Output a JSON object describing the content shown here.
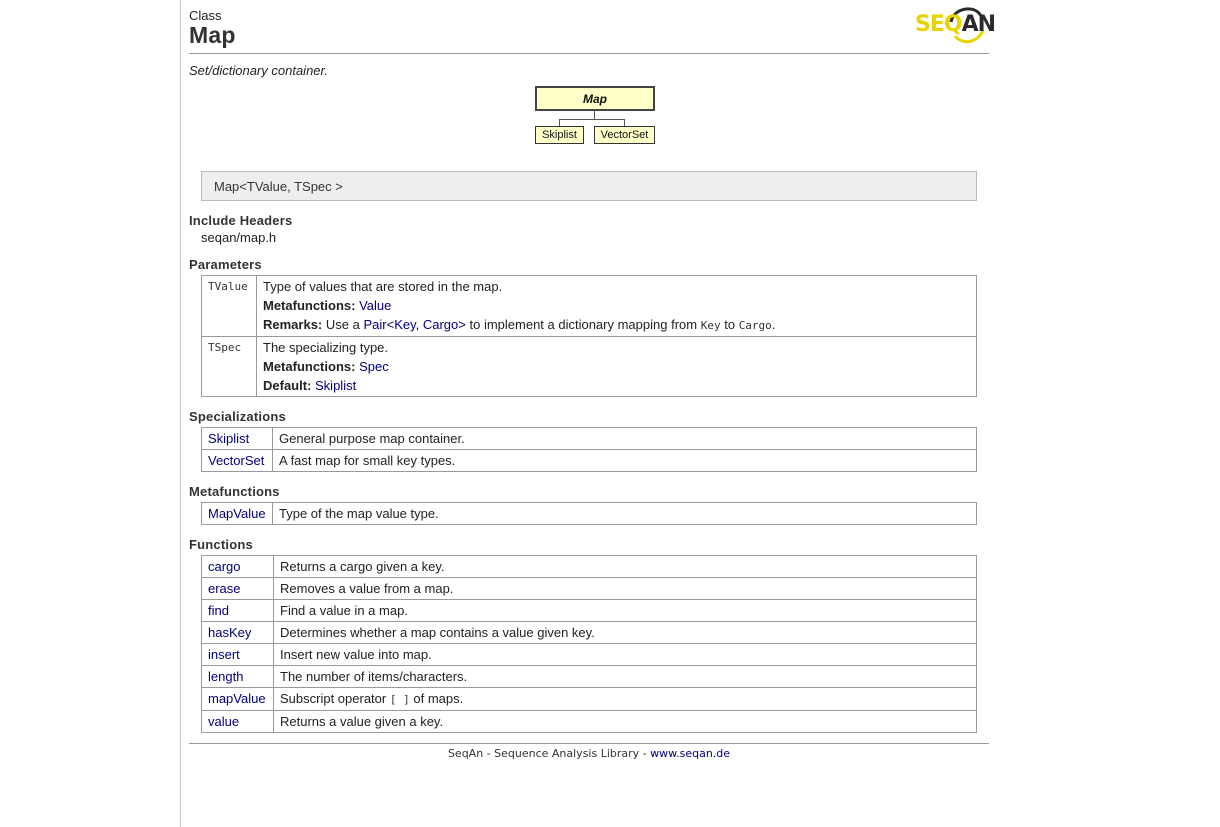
{
  "header": {
    "kind": "Class",
    "title": "Map",
    "logo_text_yellow": "SEQ",
    "logo_text_dark": "AN"
  },
  "summary": "Set/dictionary container.",
  "hierarchy": {
    "root": "Map",
    "children": [
      "Skiplist",
      "VectorSet"
    ]
  },
  "signature": "Map<TValue, TSpec >",
  "include": {
    "title": "Include Headers",
    "value": "seqan/map.h"
  },
  "parameters": {
    "title": "Parameters",
    "rows": [
      {
        "name": "TValue",
        "desc": "Type of values that are stored in the map.",
        "meta_label": "Metafunctions:",
        "meta_value": "Value",
        "remarks_label": "Remarks:",
        "remarks_pre": "Use a",
        "remarks_link": "Pair<Key, Cargo>",
        "remarks_mid": "to implement a dictionary mapping from",
        "remarks_code1": "Key",
        "remarks_to": "to",
        "remarks_code2": "Cargo",
        "remarks_end": "."
      },
      {
        "name": "TSpec",
        "desc": "The specializing type.",
        "meta_label": "Metafunctions:",
        "meta_value": "Spec",
        "default_label": "Default:",
        "default_value": "Skiplist"
      }
    ]
  },
  "specializations": {
    "title": "Specializations",
    "rows": [
      {
        "name": "Skiplist",
        "desc": "General purpose map container."
      },
      {
        "name": "VectorSet",
        "desc": "A fast map for small key types."
      }
    ]
  },
  "metafunctions": {
    "title": "Metafunctions",
    "rows": [
      {
        "name": "MapValue",
        "desc": "Type of the map value type."
      }
    ]
  },
  "functions": {
    "title": "Functions",
    "rows": [
      {
        "name": "cargo",
        "desc": "Returns a cargo given a key."
      },
      {
        "name": "erase",
        "desc": "Removes a value from a map."
      },
      {
        "name": "find",
        "desc": "Find a value in a map."
      },
      {
        "name": "hasKey",
        "desc": "Determines whether a map contains a value given key."
      },
      {
        "name": "insert",
        "desc": "Insert new value into map."
      },
      {
        "name": "length",
        "desc": "The number of items/characters."
      },
      {
        "name": "mapValue",
        "desc_pre": "Subscript operator",
        "desc_code": "[ ]",
        "desc_post": "of maps."
      },
      {
        "name": "value",
        "desc": "Returns a value given a key."
      }
    ]
  },
  "footer": {
    "text": "SeqAn - Sequence Analysis Library - ",
    "link": "www.seqan.de"
  }
}
